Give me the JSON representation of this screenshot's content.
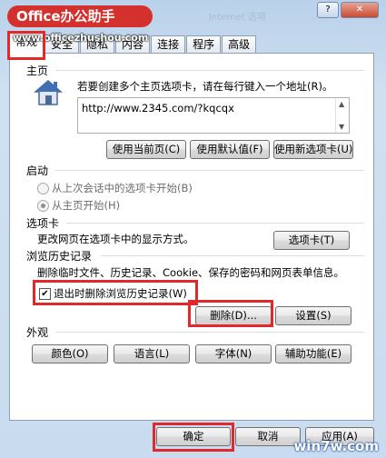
{
  "watermark_top": "Office办公助手",
  "watermark_url": "www.officezhushou.com",
  "watermark_bottom": "win7w.com",
  "blurred_title": "Internet 选项",
  "tabs": [
    "常规",
    "安全",
    "隐私",
    "内容",
    "连接",
    "程序",
    "高级"
  ],
  "home": {
    "title": "主页",
    "desc": "若要创建多个主页选项卡，请在每行键入一个地址(R)。",
    "url": "http://www.2345.com/?kqcqx",
    "btn_current": "使用当前页(C)",
    "btn_default": "使用默认值(F)",
    "btn_new": "使用新选项卡(U)"
  },
  "startup": {
    "title": "启动",
    "opt1": "从上次会话中的选项卡开始(B)",
    "opt2": "从主页开始(H)"
  },
  "tabs_group": {
    "title": "选项卡",
    "desc": "更改网页在选项卡中的显示方式。",
    "btn": "选项卡(T)"
  },
  "history": {
    "title": "浏览历史记录",
    "desc": "删除临时文件、历史记录、Cookie、保存的密码和网页表单信息。",
    "check_label": "退出时删除浏览历史记录(W)",
    "checked_mark": "✔",
    "btn_delete": "删除(D)...",
    "btn_settings": "设置(S)"
  },
  "appearance": {
    "title": "外观",
    "btn_colors": "颜色(O)",
    "btn_languages": "语言(L)",
    "btn_fonts": "字体(N)",
    "btn_access": "辅助功能(E)"
  },
  "footer": {
    "ok": "确定",
    "cancel": "取消",
    "apply": "应用(A)"
  },
  "titlebar_buttons": {
    "help": "?",
    "close": "✕"
  },
  "scroll_glyphs": {
    "up": "▲",
    "down": "▼"
  }
}
